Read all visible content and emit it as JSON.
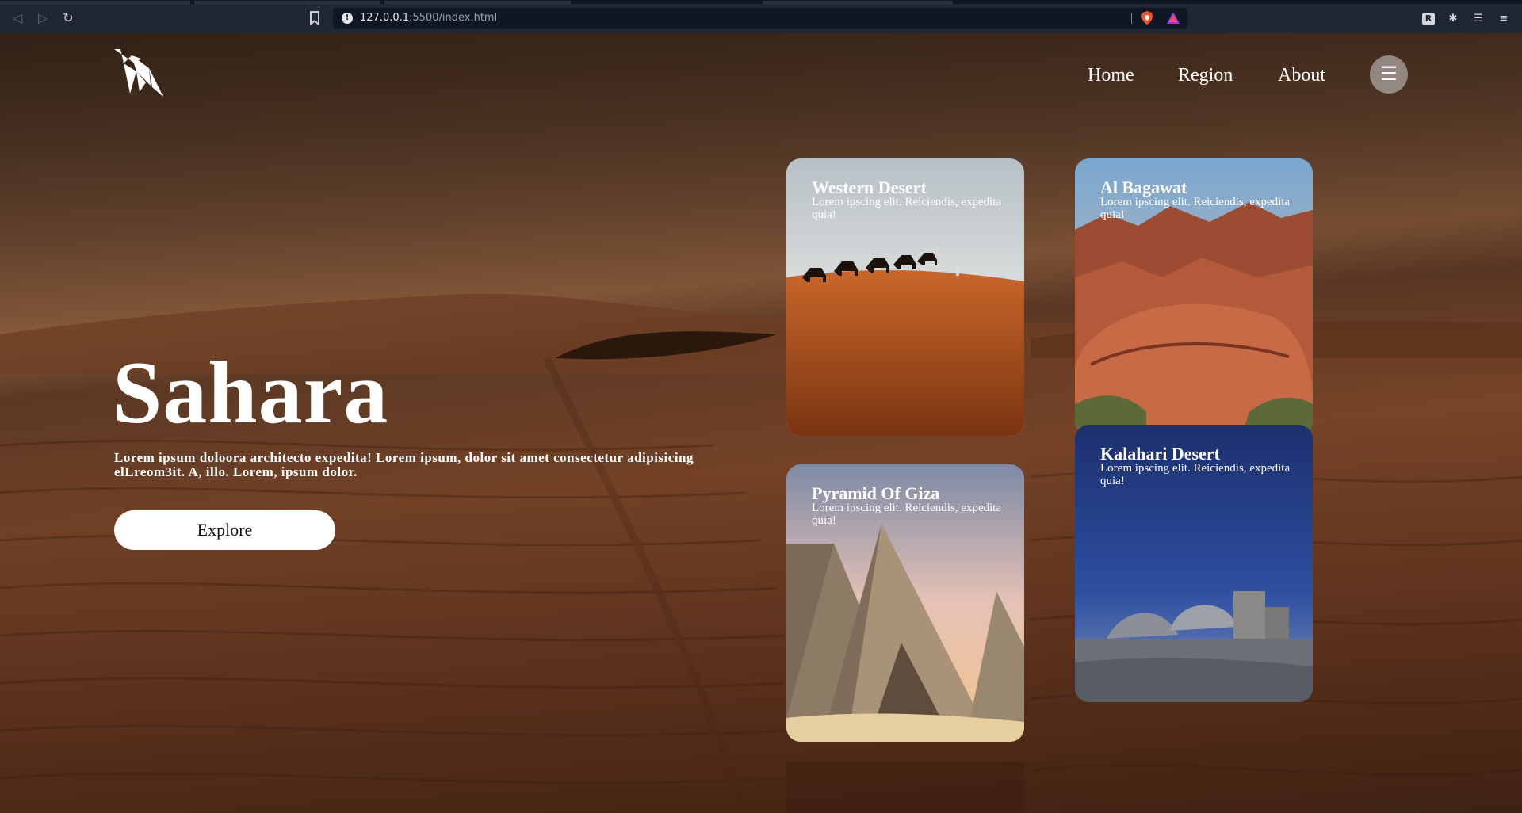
{
  "browser": {
    "url_host": "127.0.0.1",
    "url_path": ":5500/index.html",
    "extension_badge": "R"
  },
  "site": {
    "nav": [
      "Home",
      "Region",
      "About"
    ],
    "hero": {
      "title": "Sahara",
      "text": "Lorem ipsum doloora architecto expedita! Lorem ipsum, dolor sit amet consectetur adipisicing elLreom3it. A, illo. Lorem, ipsum dolor.",
      "button": "Explore"
    },
    "cards": [
      {
        "title": "Western Desert",
        "desc": "Lorem ipscing elit. Reiciendis, expedita quia!"
      },
      {
        "title": "Al Bagawat",
        "desc": "Lorem ipscing elit. Reiciendis, expedita quia!"
      },
      {
        "title": "Pyramid Of Giza",
        "desc": "Lorem ipscing elit. Reiciendis, expedita quia!"
      },
      {
        "title": "Kalahari Desert",
        "desc": "Lorem ipscing elit. Reiciendis, expedita quia!"
      }
    ]
  },
  "colors": {
    "chrome": "#202633",
    "url_bar": "#101622",
    "accent_text": "#ffffff"
  }
}
